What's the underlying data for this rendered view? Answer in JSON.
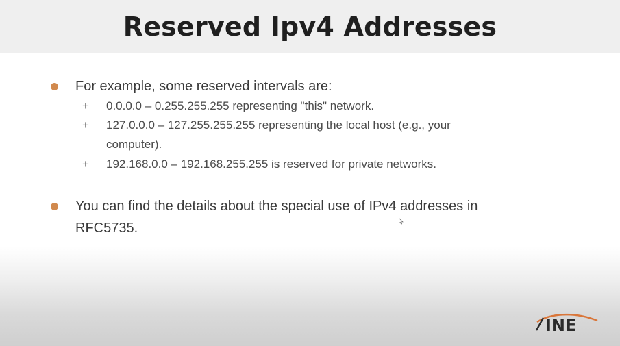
{
  "slide": {
    "title": "Reserved Ipv4 Addresses",
    "bullets": [
      {
        "text": "For example, some reserved intervals are:",
        "subitems": [
          {
            "line1": "0.0.0.0 – 0.255.255.255 representing \"this\" network."
          },
          {
            "line1": "127.0.0.0 – 127.255.255.255 representing the local host (e.g., your",
            "line2": "computer)."
          },
          {
            "line1": "192.168.0.0 – 192.168.255.255 is reserved for private networks."
          }
        ]
      },
      {
        "line1": "You can find the details about the special use of IPv4 addresses in",
        "line2": "RFC5735."
      }
    ],
    "sub_marker": "+",
    "logo": {
      "icon": "ine-logo",
      "text": "INE"
    }
  },
  "colors": {
    "bullet": "#d1894d",
    "title_bar": "#efefef",
    "logo_orange": "#d9763a",
    "logo_dark": "#2a2a2a"
  }
}
